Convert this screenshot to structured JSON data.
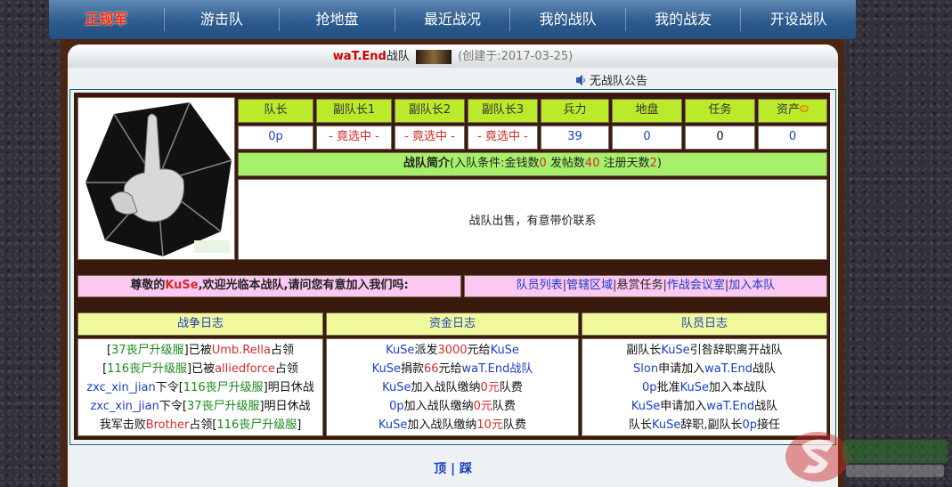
{
  "nav": [
    "正规军",
    "游击队",
    "抢地盘",
    "最近战况",
    "我的战队",
    "我的战友",
    "开设战队"
  ],
  "header": {
    "team_name": "waT.End",
    "team_suffix": "战队",
    "created": "(创建于:2017-03-25)",
    "notice": "无战队公告"
  },
  "stats": {
    "headers": [
      "队长",
      "副队长1",
      "副队长2",
      "副队长3",
      "兵力",
      "地盘",
      "任务",
      "资产"
    ],
    "values": [
      "0p",
      "- 竟选中 -",
      "- 竟选中 -",
      "- 竟选中 -",
      "39",
      "0",
      "0",
      "0"
    ]
  },
  "intro": {
    "label": "战队简介",
    "cond_prefix": "(入队条件:金钱数",
    "money": "0",
    "posts_label": " 发帖数",
    "posts": "40",
    "days_label": " 注册天数",
    "days": "2",
    "close": ")",
    "description": "战队出售，有意带价联系"
  },
  "welcome": {
    "prefix": "尊敬的",
    "user": "KuSe",
    "suffix": ",欢迎光临本战队,请问您有意加入我们吗:"
  },
  "links": [
    "队员列表",
    "管辖区域",
    "悬赏任务",
    "作战会议室",
    "加入本队"
  ],
  "logs": {
    "war_title": "战争日志",
    "fund_title": "资金日志",
    "member_title": "队员日志",
    "war": [
      [
        [
          "[",
          "dark"
        ],
        [
          "37丧尸升级服",
          "green"
        ],
        [
          "]已被",
          "dark"
        ],
        [
          "Umb.Rella",
          "red"
        ],
        [
          "占领",
          "dark"
        ]
      ],
      [
        [
          "[",
          "dark"
        ],
        [
          "116丧尸升级服",
          "green"
        ],
        [
          "]已被",
          "dark"
        ],
        [
          "alliedforce",
          "red"
        ],
        [
          "占领",
          "dark"
        ]
      ],
      [
        [
          "zxc_xin_jian",
          "blue"
        ],
        [
          "下令[",
          "dark"
        ],
        [
          "116丧尸升级服",
          "green"
        ],
        [
          "]明日休战",
          "dark"
        ]
      ],
      [
        [
          "zxc_xin_jian",
          "blue"
        ],
        [
          "下令[",
          "dark"
        ],
        [
          "37丧尸升级服",
          "green"
        ],
        [
          "]明日休战",
          "dark"
        ]
      ],
      [
        [
          "我军击败",
          "dark"
        ],
        [
          "Brother",
          "red"
        ],
        [
          "占领[",
          "dark"
        ],
        [
          "116丧尸升级服",
          "green"
        ],
        [
          "]",
          "dark"
        ]
      ]
    ],
    "fund": [
      [
        [
          "KuSe",
          "blue"
        ],
        [
          "派发",
          "dark"
        ],
        [
          "3000",
          "red"
        ],
        [
          "元给",
          "dark"
        ],
        [
          "KuSe",
          "blue"
        ]
      ],
      [
        [
          "KuSe",
          "blue"
        ],
        [
          "捐款",
          "dark"
        ],
        [
          "66",
          "red"
        ],
        [
          "元给",
          "dark"
        ],
        [
          "waT.End战队",
          "blue"
        ]
      ],
      [
        [
          "KuSe",
          "blue"
        ],
        [
          "加入战队缴纳",
          "dark"
        ],
        [
          "0元",
          "red"
        ],
        [
          "队费",
          "dark"
        ]
      ],
      [
        [
          "0p",
          "blue"
        ],
        [
          "加入战队缴纳",
          "dark"
        ],
        [
          "0元",
          "red"
        ],
        [
          "队费",
          "dark"
        ]
      ],
      [
        [
          "KuSe",
          "blue"
        ],
        [
          "加入战队缴纳",
          "dark"
        ],
        [
          "10元",
          "red"
        ],
        [
          "队费",
          "dark"
        ]
      ]
    ],
    "member": [
      [
        [
          "副队长",
          "dark"
        ],
        [
          "KuSe",
          "blue"
        ],
        [
          "引咎辞职离开战队",
          "dark"
        ]
      ],
      [
        [
          "Slon",
          "blue"
        ],
        [
          "申请加入",
          "dark"
        ],
        [
          "waT.End",
          "blue"
        ],
        [
          "战队",
          "dark"
        ]
      ],
      [
        [
          "0p",
          "blue"
        ],
        [
          "批准",
          "dark"
        ],
        [
          "KuSe",
          "blue"
        ],
        [
          "加入本战队",
          "dark"
        ]
      ],
      [
        [
          "KuSe",
          "blue"
        ],
        [
          "申请加入",
          "dark"
        ],
        [
          "waT.End",
          "blue"
        ],
        [
          "战队",
          "dark"
        ]
      ],
      [
        [
          "队长",
          "dark"
        ],
        [
          "KuSe",
          "blue"
        ],
        [
          "辞职,副队长",
          "dark"
        ],
        [
          "0p",
          "blue"
        ],
        [
          "接任",
          "dark"
        ]
      ]
    ]
  },
  "footer": {
    "top": "顶",
    "sep": "|",
    "step": "踩"
  },
  "colors": {
    "nav_bg": "#2d5b8e",
    "head_green": "#bbea2b",
    "intro_green": "#a7f06a",
    "pink": "#fbc8f2",
    "log_yellow": "#f0fa9a",
    "link_blue": "#1a3fc6",
    "highlight_red": "#d32b2b"
  }
}
